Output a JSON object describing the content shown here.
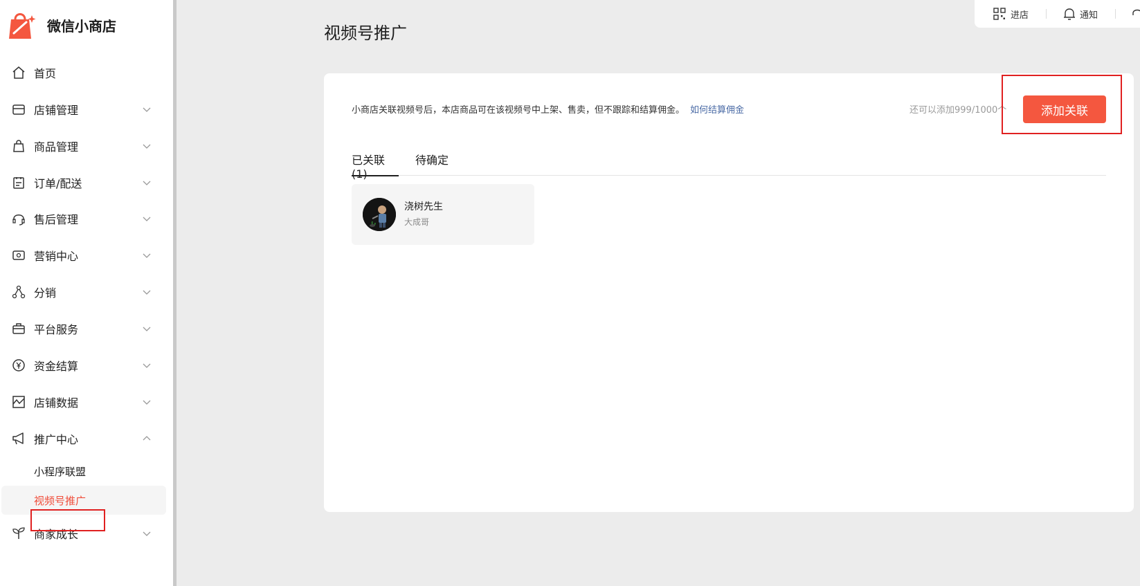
{
  "brand": {
    "name": "微信小商店",
    "accent": "#f4573f"
  },
  "sidebar": {
    "items": [
      {
        "label": "首页",
        "icon": "home-icon",
        "expandable": false
      },
      {
        "label": "店铺管理",
        "icon": "store-icon",
        "expandable": true
      },
      {
        "label": "商品管理",
        "icon": "bag-icon",
        "expandable": true
      },
      {
        "label": "订单/配送",
        "icon": "clipboard-icon",
        "expandable": true
      },
      {
        "label": "售后管理",
        "icon": "headset-icon",
        "expandable": true
      },
      {
        "label": "营销中心",
        "icon": "ticket-icon",
        "expandable": true
      },
      {
        "label": "分销",
        "icon": "share-nodes-icon",
        "expandable": true
      },
      {
        "label": "平台服务",
        "icon": "briefcase-icon",
        "expandable": true
      },
      {
        "label": "资金结算",
        "icon": "yuan-icon",
        "expandable": true
      },
      {
        "label": "店铺数据",
        "icon": "chart-icon",
        "expandable": true
      },
      {
        "label": "推广中心",
        "icon": "megaphone-icon",
        "expandable": true,
        "expanded": true
      },
      {
        "label": "商家成长",
        "icon": "sprout-icon",
        "expandable": true
      }
    ],
    "sub_items": [
      {
        "label": "小程序联盟"
      },
      {
        "label": "视频号推广",
        "active": true
      }
    ]
  },
  "topbar": {
    "shop_label": "进店",
    "notify_label": "通知"
  },
  "main": {
    "title": "视频号推广",
    "description": "小商店关联视频号后，本店商品可在该视频号中上架、售卖，但不跟踪和结算佣金。",
    "link": "如何结算佣金",
    "quota": "还可以添加999/1000个",
    "add_button": "添加关联",
    "tabs": [
      {
        "label": "已关联(1)",
        "active": true
      },
      {
        "label": "待确定",
        "active": false
      }
    ],
    "accounts": [
      {
        "name": "浇树先生",
        "subtitle": "大成哥"
      }
    ]
  }
}
